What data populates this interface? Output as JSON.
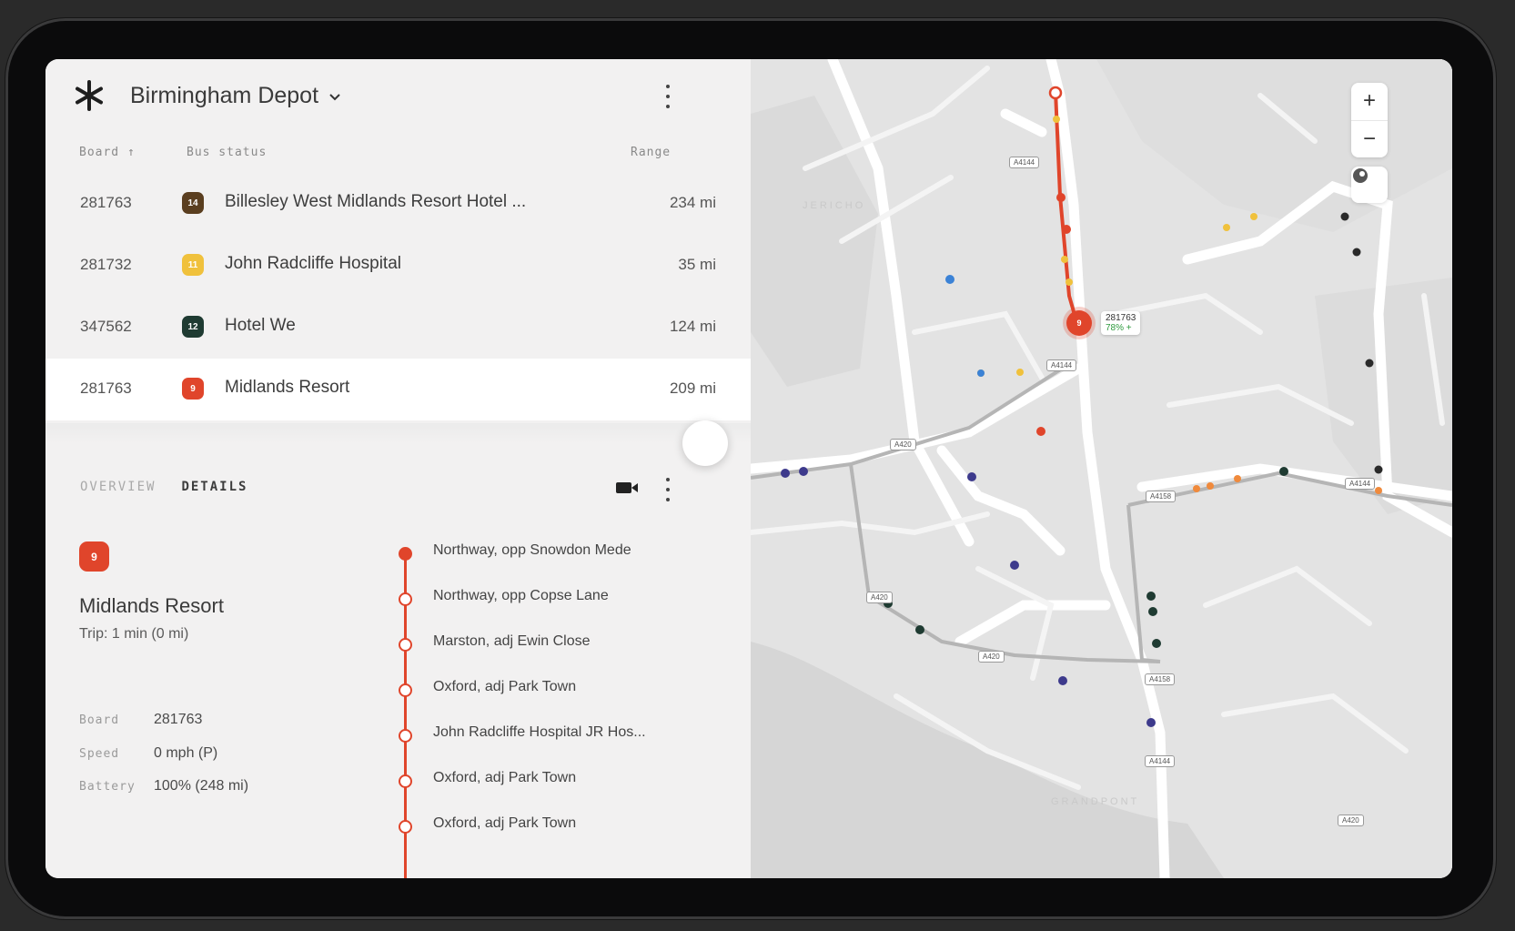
{
  "header": {
    "depot_name": "Birmingham Depot"
  },
  "columns": {
    "board": "Board ↑",
    "bus_status": "Bus status",
    "range": "Range"
  },
  "buses": [
    {
      "board": "281763",
      "badge_label": "14",
      "badge_color": "#5a3e1f",
      "destination": "Billesley West Midlands Resort Hotel ...",
      "range": "234 mi"
    },
    {
      "board": "281732",
      "badge_label": "11",
      "badge_color": "#f0c13c",
      "destination": "John Radcliffe Hospital",
      "range": "35 mi"
    },
    {
      "board": "347562",
      "badge_label": "12",
      "badge_color": "#1f3b32",
      "destination": "Hotel We",
      "range": "124 mi"
    },
    {
      "board": "281763",
      "badge_label": "9",
      "badge_color": "#e0452b",
      "destination": "Midlands Resort",
      "range": "209 mi"
    }
  ],
  "tabs": {
    "overview": "OVERVIEW",
    "details": "DETAILS"
  },
  "detail": {
    "badge_label": "9",
    "title": "Midlands Resort",
    "trip": "Trip: 1 min (0 mi)",
    "board_label": "Board",
    "board_value": "281763",
    "speed_label": "Speed",
    "speed_value": "0 mph (P)",
    "battery_label": "Battery",
    "battery_value": "100% (248 mi)"
  },
  "stops": [
    "Northway, opp Snowdon Mede",
    "Northway, opp Copse Lane",
    "Marston, adj Ewin Close",
    "Oxford, adj Park Town",
    "John Radcliffe Hospital JR Hos...",
    "Oxford, adj Park Town",
    "Oxford, adj Park Town"
  ],
  "map": {
    "zoom_in": "+",
    "zoom_out": "−",
    "bus_marker_label": "9",
    "bus_callout_id": "281763",
    "bus_callout_pct": "78% +",
    "area_labels": [
      "JERICHO",
      "GRANDPONT"
    ],
    "road_labels": [
      "A4144",
      "A4144",
      "A420",
      "A4158",
      "A4144",
      "A420",
      "A420",
      "A4158",
      "A4144",
      "A420"
    ],
    "colors": {
      "route_red": "#e0452b",
      "route_gray": "#b5b5b5",
      "stop_yellow": "#f0c13c",
      "stop_orange": "#f08a3c",
      "stop_dark": "#2a2a2a",
      "stop_navy": "#3d3a8c",
      "stop_green": "#1f3b32",
      "stop_blue": "#3b82d6"
    }
  }
}
